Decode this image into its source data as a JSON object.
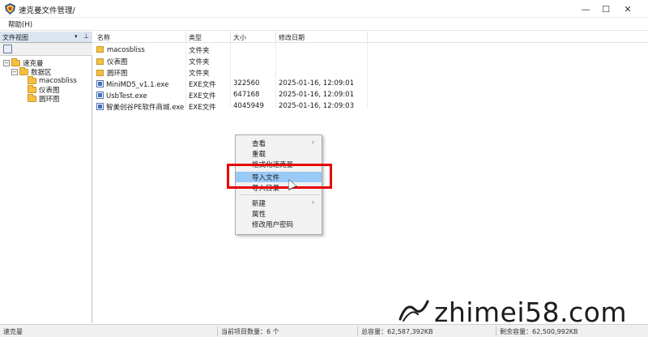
{
  "window": {
    "title": "速克曼文件管理/",
    "min_glyph": "—",
    "max_glyph": "☐",
    "close_glyph": "✕"
  },
  "menu": {
    "help": "帮助(H)"
  },
  "left_panel": {
    "header": "文件视图",
    "dropdown_glyph": "▾",
    "pin_glyph": "⊥",
    "tree": [
      {
        "label": "速克曼",
        "toggle": "−"
      },
      {
        "label": "数据区",
        "toggle": "−"
      },
      {
        "label": "macosbliss"
      },
      {
        "label": "仪表图"
      },
      {
        "label": "圆环图"
      }
    ]
  },
  "file_list": {
    "columns": {
      "name": "名称",
      "type": "类型",
      "size": "大小",
      "date": "修改日期"
    },
    "rows": [
      {
        "name": "macosbliss",
        "type": "文件夹",
        "size": "",
        "date": "",
        "kind": "folder"
      },
      {
        "name": "仪表图",
        "type": "文件夹",
        "size": "",
        "date": "",
        "kind": "folder"
      },
      {
        "name": "圆环图",
        "type": "文件夹",
        "size": "",
        "date": "",
        "kind": "folder"
      },
      {
        "name": "MiniMD5_v1.1.exe",
        "type": "EXE文件",
        "size": "322560",
        "date": "2025-01-16, 12:09:01",
        "kind": "file"
      },
      {
        "name": "UsbTest.exe",
        "type": "EXE文件",
        "size": "647168",
        "date": "2025-01-16, 12:09:01",
        "kind": "file"
      },
      {
        "name": "智美创谷PE软件商城.exe",
        "type": "EXE文件",
        "size": "4045949",
        "date": "2025-01-16, 12:09:03",
        "kind": "file"
      }
    ]
  },
  "context_menu": {
    "items": [
      {
        "label": "查看",
        "submenu": true
      },
      {
        "label": "重载"
      },
      {
        "label": "格式化速克曼"
      },
      {
        "label": "导入文件",
        "highlighted": true
      },
      {
        "label": "导入目录"
      },
      {
        "label": "新建",
        "submenu": true
      },
      {
        "label": "属性"
      },
      {
        "label": "修改用户密码"
      }
    ],
    "submenu_glyph": "›",
    "highlight_color": "#99c9f5",
    "annotation_color": "#e60000"
  },
  "status_bar": {
    "left": "速克曼",
    "count": "当前项目数量：6 个",
    "total": "总容量：62,587,392KB",
    "free": "剩余容量：62,500,992KB"
  },
  "watermark": {
    "text": "zhimei58.com"
  }
}
